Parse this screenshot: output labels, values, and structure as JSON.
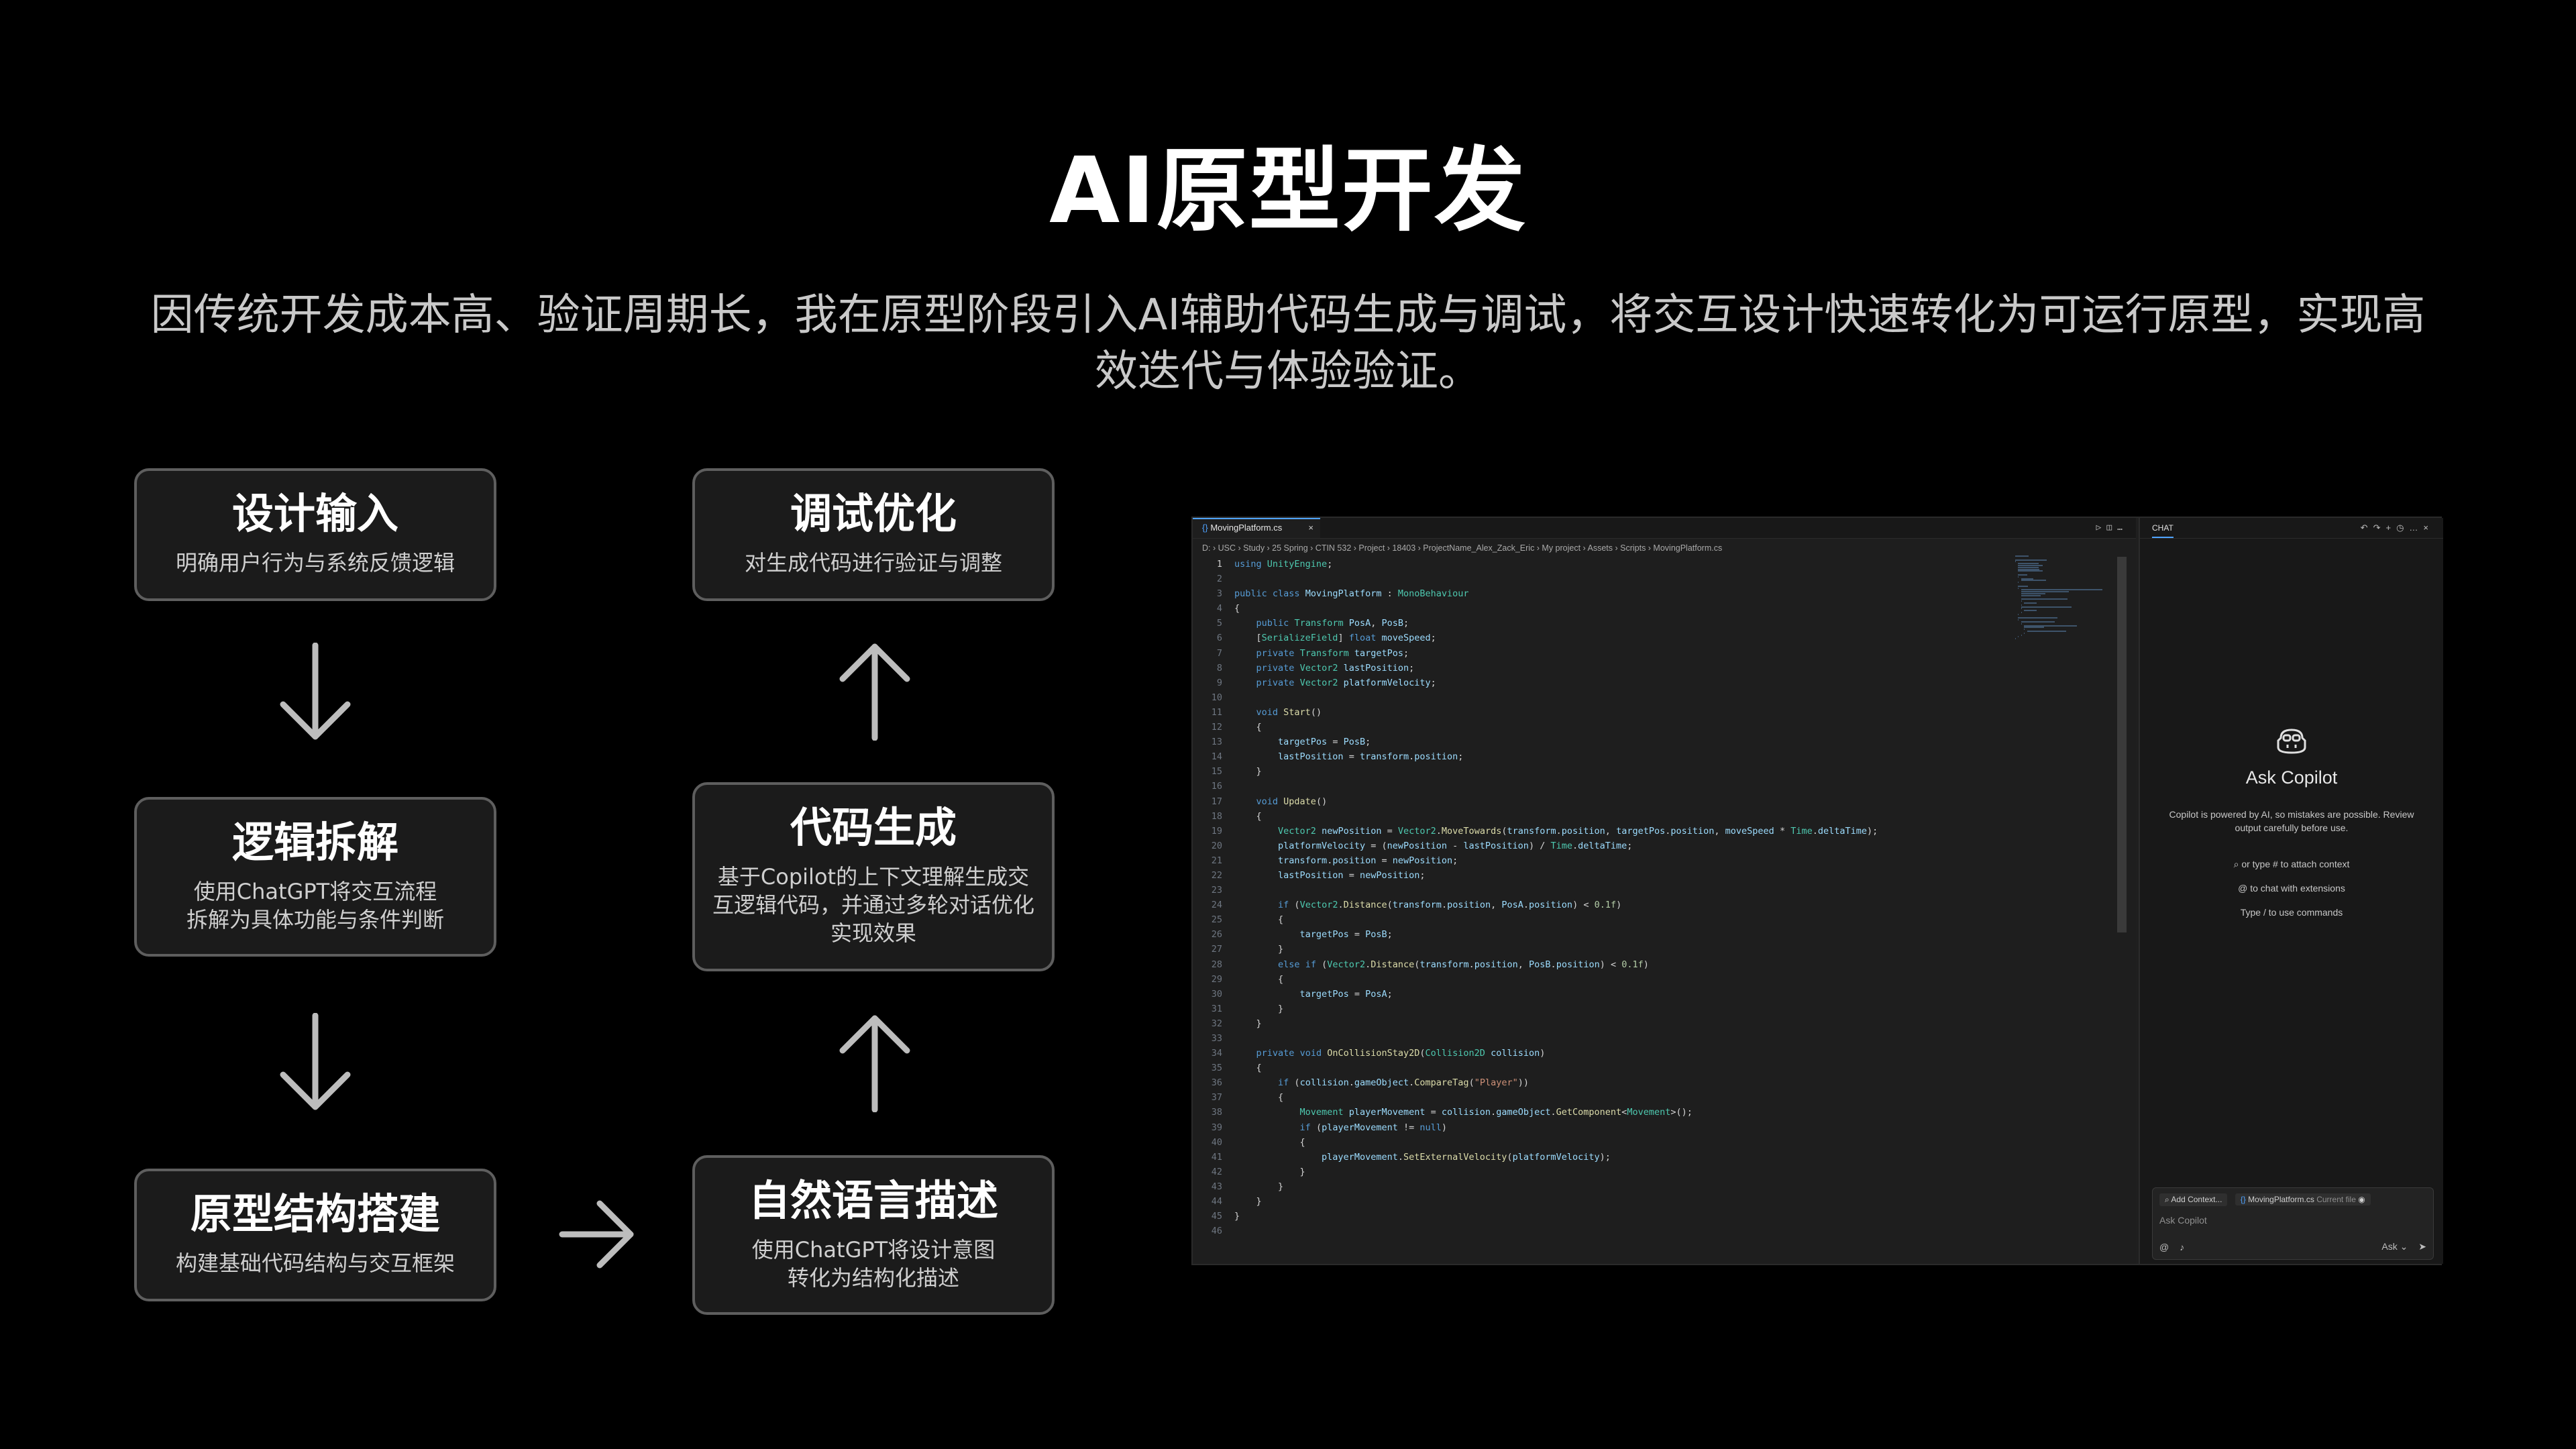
{
  "title": "AI原型开发",
  "subtitle_line1": "因传统开发成本高、验证周期长，我在原型阶段引入AI辅助代码生成与调试，将交互设计快速转化为可运行原型，实现高",
  "subtitle_line2": "效迭代与体验验证。",
  "flow": {
    "design_input": {
      "title": "设计输入",
      "desc": [
        "明确用户行为与系统反馈逻辑"
      ]
    },
    "logic_breakdown": {
      "title": "逻辑拆解",
      "desc": [
        "使用ChatGPT将交互流程",
        "拆解为具体功能与条件判断"
      ]
    },
    "prototype_build": {
      "title": "原型结构搭建",
      "desc": [
        "构建基础代码结构与交互框架"
      ]
    },
    "natural_language": {
      "title": "自然语言描述",
      "desc": [
        "使用ChatGPT将设计意图",
        "转化为结构化描述"
      ]
    },
    "code_generation": {
      "title": "代码生成",
      "desc": [
        "基于Copilot的上下文理解生成交",
        "互逻辑代码，并通过多轮对话优化",
        "实现效果"
      ]
    },
    "debug_optimize": {
      "title": "调试优化",
      "desc": [
        "对生成代码进行验证与调整"
      ]
    }
  },
  "ide": {
    "tab_label": "MovingPlatform.cs",
    "tab_close": "×",
    "breadcrumb": "D: › USC › Study › 25 Spring › CTIN 532 › Project › 18403 › ProjectName_Alex_Zack_Eric › My project › Assets › Scripts › MovingPlatform.cs",
    "code_lines": [
      "using UnityEngine;",
      "",
      "public class MovingPlatform : MonoBehaviour",
      "{",
      "    public Transform PosA, PosB;",
      "    [SerializeField] float moveSpeed;",
      "    private Transform targetPos;",
      "    private Vector2 lastPosition;",
      "    private Vector2 platformVelocity;",
      "",
      "    void Start()",
      "    {",
      "        targetPos = PosB;",
      "        lastPosition = transform.position;",
      "    }",
      "",
      "    void Update()",
      "    {",
      "        Vector2 newPosition = Vector2.MoveTowards(transform.position, targetPos.position, moveSpeed * Time.deltaTime);",
      "        platformVelocity = (newPosition - lastPosition) / Time.deltaTime;",
      "        transform.position = newPosition;",
      "        lastPosition = newPosition;",
      "",
      "        if (Vector2.Distance(transform.position, PosA.position) < 0.1f)",
      "        {",
      "            targetPos = PosB;",
      "        }",
      "        else if (Vector2.Distance(transform.position, PosB.position) < 0.1f)",
      "        {",
      "            targetPos = PosA;",
      "        }",
      "    }",
      "",
      "    private void OnCollisionStay2D(Collision2D collision)",
      "    {",
      "        if (collision.gameObject.CompareTag(\"Player\"))",
      "        {",
      "            Movement playerMovement = collision.gameObject.GetComponent<Movement>();",
      "            if (playerMovement != null)",
      "            {",
      "                playerMovement.SetExternalVelocity(platformVelocity);",
      "            }",
      "        }",
      "    }",
      "}",
      ""
    ],
    "chat": {
      "tab": "CHAT",
      "heading": "Ask Copilot",
      "note": "Copilot is powered by AI, so mistakes are possible. Review output carefully before use.",
      "hint1": "or type # to attach context",
      "hint2": "to chat with extensions",
      "hint3": "Type / to use commands",
      "add_context": "Add Context...",
      "file_chip": "MovingPlatform.cs",
      "file_chip_note": "Current file",
      "input_placeholder": "Ask Copilot",
      "mode": "Ask"
    }
  },
  "colors": {
    "background": "#000000",
    "box_bg": "#1b1b1b",
    "box_border": "#5e5e5e",
    "arrow": "#bdbdbd",
    "code_keyword": "#569cd6",
    "code_type": "#4ec9b0",
    "code_string": "#ce9178",
    "code_number": "#b5cea8",
    "code_method": "#dcdcaa"
  }
}
